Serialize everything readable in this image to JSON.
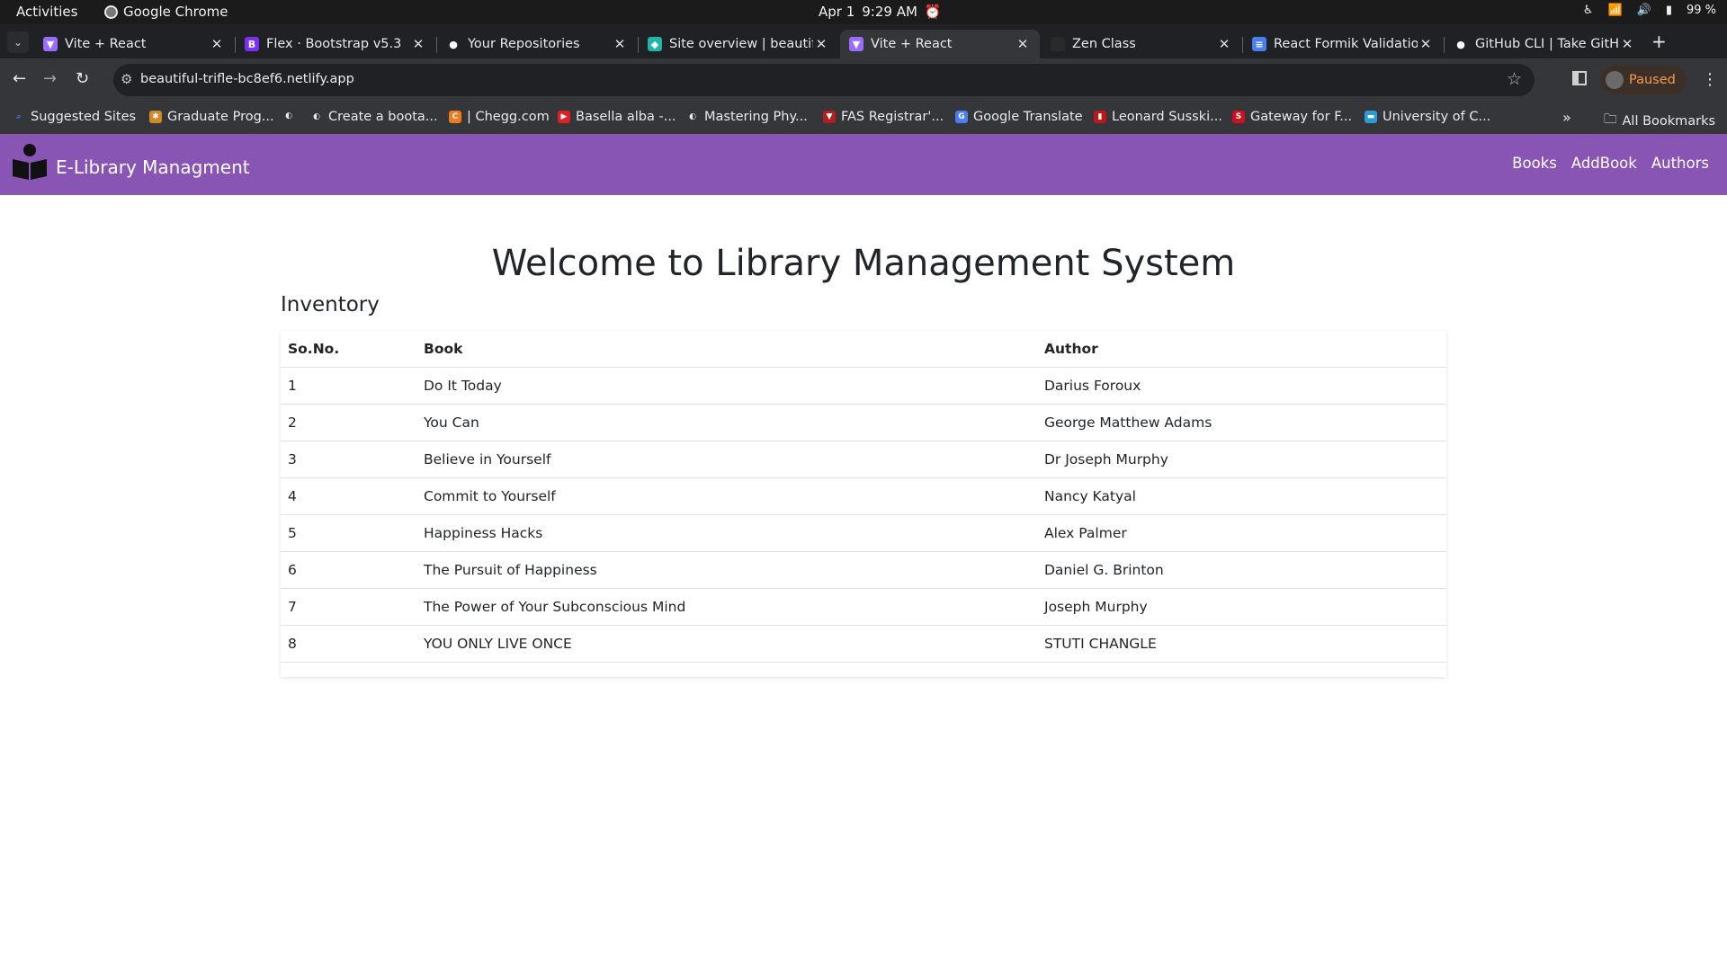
{
  "os_bar": {
    "activities": "Activities",
    "app_name": "Google Chrome",
    "date": "Apr 1",
    "time": "9:29 AM",
    "battery": "99 %"
  },
  "tabs": [
    {
      "title": "Vite + React",
      "icon": "vite-icon",
      "active": false
    },
    {
      "title": "Flex · Bootstrap v5.3",
      "icon": "bootstrap-icon",
      "active": false
    },
    {
      "title": "Your Repositories",
      "icon": "github-icon",
      "active": false
    },
    {
      "title": "Site overview | beautif",
      "icon": "netlify-icon",
      "active": false
    },
    {
      "title": "Vite + React",
      "icon": "vite-icon",
      "active": true
    },
    {
      "title": "Zen Class",
      "icon": "zen-icon",
      "active": false
    },
    {
      "title": "React Formik Validatio",
      "icon": "docs-icon",
      "active": false
    },
    {
      "title": "GitHub CLI | Take GitH",
      "icon": "github-icon",
      "active": false
    }
  ],
  "toolbar": {
    "url": "beautiful-trifle-bc8ef6.netlify.app",
    "profile_status": "Paused"
  },
  "bookmarks": [
    {
      "label": "Suggested Sites"
    },
    {
      "label": "Graduate Prog..."
    },
    {
      "label": ""
    },
    {
      "label": "Create a boota..."
    },
    {
      "label": "| Chegg.com"
    },
    {
      "label": "Basella alba -..."
    },
    {
      "label": "Mastering Phy..."
    },
    {
      "label": "FAS Registrar'..."
    },
    {
      "label": "Google Translate"
    },
    {
      "label": "Leonard Susski..."
    },
    {
      "label": "Gateway for F..."
    },
    {
      "label": "University of C..."
    }
  ],
  "all_bookmarks": "All Bookmarks",
  "app": {
    "brand": "E-Library Managment",
    "nav": [
      "Books",
      "AddBook",
      "Authors"
    ],
    "heading": "Welcome to Library Management System",
    "section": "Inventory",
    "columns": [
      "So.No.",
      "Book",
      "Author"
    ],
    "rows": [
      [
        "1",
        "Do It Today",
        "Darius Foroux"
      ],
      [
        "2",
        "You Can",
        "George Matthew Adams"
      ],
      [
        "3",
        "Believe in Yourself",
        "Dr Joseph Murphy"
      ],
      [
        "4",
        "Commit to Yourself",
        "Nancy Katyal"
      ],
      [
        "5",
        "Happiness Hacks",
        "Alex Palmer"
      ],
      [
        "6",
        "The Pursuit of Happiness",
        "Daniel G. Brinton"
      ],
      [
        "7",
        "The Power of Your Subconscious Mind",
        "Joseph Murphy"
      ],
      [
        "8",
        "YOU ONLY LIVE ONCE",
        "STUTI CHANGLE"
      ]
    ]
  },
  "colors": {
    "navbar": "#8955b5",
    "chrome_dark": "#202124",
    "chrome_toolbar": "#35363a"
  }
}
